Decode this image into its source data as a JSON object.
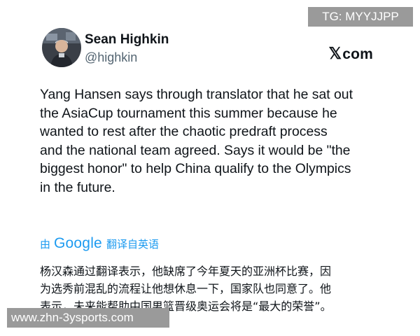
{
  "author": {
    "name": "Sean Highkin",
    "handle": "@highkin"
  },
  "source_label": "com",
  "source_brand_glyph": "𝕏",
  "tweet": {
    "lines": [
      "Yang Hansen says through translator that he sat out",
      "the AsiaCup tournament this summer because he",
      "wanted to rest after the chaotic predraft process",
      "and the national team agreed. Says it would be \"the",
      "biggest honor\" to help China qualify to the Olympics",
      "in the future."
    ]
  },
  "translation": {
    "prefix": "由",
    "google": "Google",
    "suffix": "翻译自英语",
    "lines": [
      "杨汉森通过翻译表示，他缺席了今年夏天的亚洲杯比赛，因",
      "为选秀前混乱的流程让他想休息一下，国家队也同意了。他",
      "表示，未来能帮助中国男篮晋级奥运会将是“最大的荣誉”。"
    ]
  },
  "overlays": {
    "tg": "TG: MYYJJPP",
    "site": "www.zhn-3ysports.com"
  },
  "colors": {
    "link_blue": "#1d9bf0",
    "text": "#0f1419",
    "secondary": "#536471",
    "overlay_gray": "#9a9a9a"
  },
  "icons": {
    "avatar": "profile-photo",
    "brand": "x-logo-icon"
  }
}
